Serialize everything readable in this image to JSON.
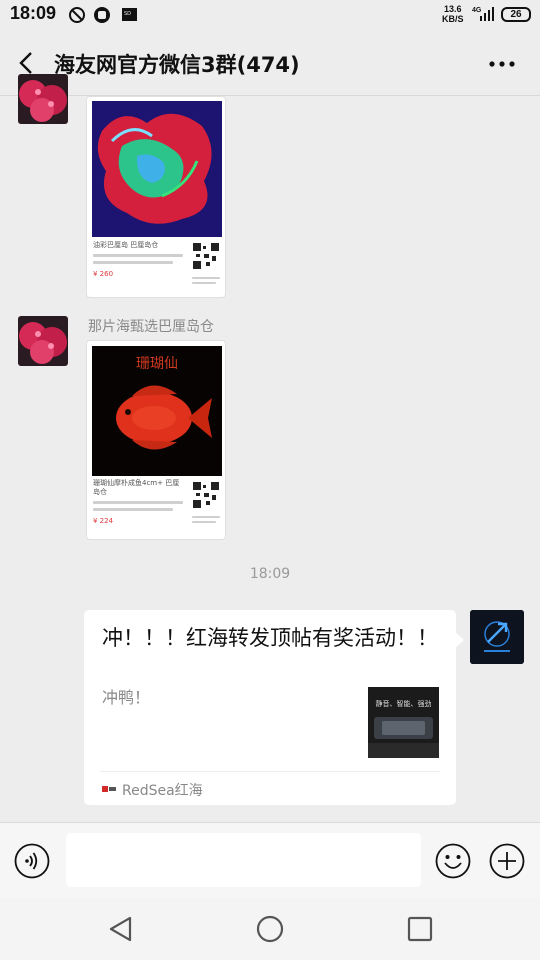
{
  "status_bar": {
    "time": "18:09",
    "speed_value": "13.6",
    "speed_unit": "KB/S",
    "network": "4G",
    "battery": "26",
    "icons": [
      "alarm-off-icon",
      "shield-icon",
      "sd-card-icon"
    ]
  },
  "header": {
    "title": "海友网官方微信3群(474)",
    "back_icon": "chevron-left-icon",
    "more_icon": "more-dots-icon"
  },
  "messages": [
    {
      "type": "image-card",
      "sender_name": "",
      "card_title": "油彩巴厘岛 巴厘岛仓",
      "price": "¥ 260"
    },
    {
      "type": "image-card",
      "sender_name": "那片海甄选巴厘岛仓",
      "card_title": "珊瑚仙摩朴成鱼4cm+ 巴厘岛仓",
      "price": "¥ 224",
      "image_caption": "珊瑚仙"
    }
  ],
  "timestamp": "18:09",
  "link_card": {
    "title": "冲！！！红海转发顶帖有奖活动！！",
    "description": "冲鸭！",
    "thumb_text": "静音、智能、强劲",
    "source_name": "RedSea红海"
  },
  "input_bar": {
    "voice_icon": "voice-icon",
    "emoji_icon": "emoji-icon",
    "plus_icon": "plus-icon",
    "input_value": ""
  },
  "nav_bar": {
    "icons": [
      "back-triangle-icon",
      "home-circle-icon",
      "recents-square-icon"
    ]
  },
  "colors": {
    "background": "#ededed",
    "bubble": "#ffffff",
    "price_red": "#e0393e"
  }
}
